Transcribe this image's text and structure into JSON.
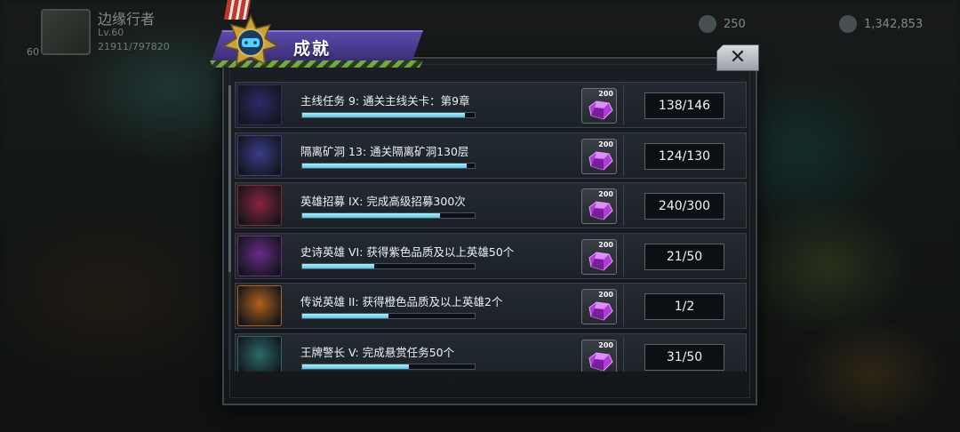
{
  "player": {
    "name": "边缘行者",
    "level": "Lv.60",
    "exp": "21911/797820",
    "badge_level": "60"
  },
  "resources": {
    "energy": "250",
    "gold": "1,342,853"
  },
  "dialog": {
    "title": "成就",
    "close_label": "✕"
  },
  "achievements": [
    {
      "task": "主线任务 9: 通关主线关卡：第9章",
      "progress": "138/146",
      "fraction": 0.945,
      "reward_qty": "200",
      "icon": "checkered-flag-icon",
      "icon_color": "#2c2a6e"
    },
    {
      "task": "隔离矿洞 13: 通关隔离矿洞130层",
      "progress": "124/130",
      "fraction": 0.954,
      "reward_qty": "200",
      "icon": "mine-gem-icon",
      "icon_color": "#3a3d8c"
    },
    {
      "task": "英雄招募 IX: 完成高级招募300次",
      "progress": "240/300",
      "fraction": 0.8,
      "reward_qty": "200",
      "icon": "recruit-question-icon",
      "icon_color": "#8c2440"
    },
    {
      "task": "史诗英雄 VI: 获得紫色品质及以上英雄50个",
      "progress": "21/50",
      "fraction": 0.42,
      "reward_qty": "200",
      "icon": "epic-hero-icon",
      "icon_color": "#6b2a88"
    },
    {
      "task": "传说英雄 II: 获得橙色品质及以上英雄2个",
      "progress": "1/2",
      "fraction": 0.5,
      "reward_qty": "200",
      "icon": "legend-hero-icon",
      "icon_color": "#b0601c"
    },
    {
      "task": "王牌警长 V: 完成悬赏任务50个",
      "progress": "31/50",
      "fraction": 0.62,
      "reward_qty": "200",
      "icon": "sheriff-badge-icon",
      "icon_color": "#2a6a6a"
    }
  ]
}
